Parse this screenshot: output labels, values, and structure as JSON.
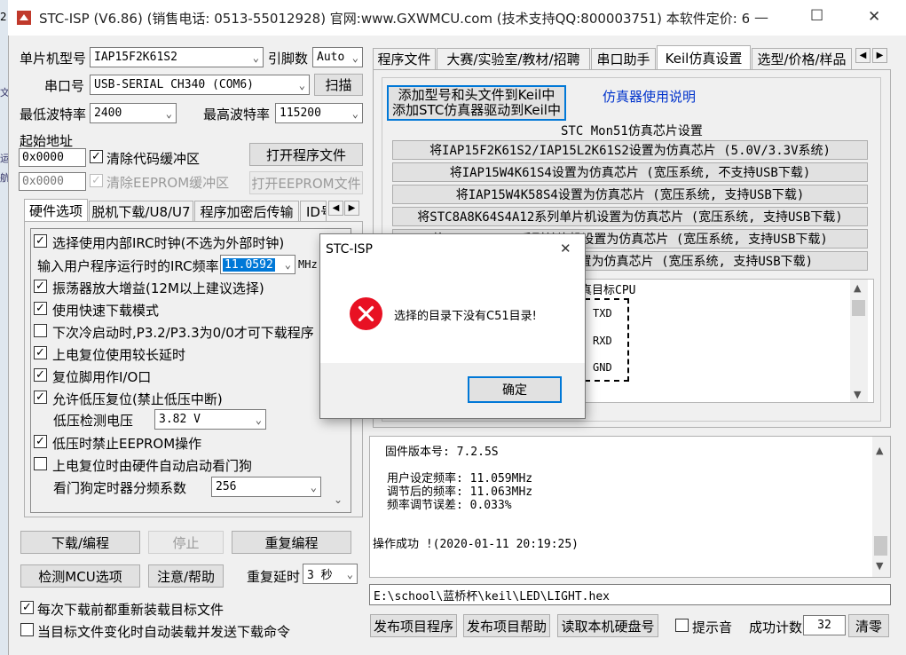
{
  "titlebar": {
    "title": "STC-ISP (V6.86) (销售电话: 0513-55012928) 官网:www.GXWMCU.com  (技术支持QQ:800003751) 本软件定价: 6...",
    "left_strip": "2",
    "minimize_glyph": "—",
    "maximize_glyph": "☐",
    "close_glyph": "✕"
  },
  "left_strip_chars": [
    "文",
    "运",
    "航"
  ],
  "mcu": {
    "model_label": "单片机型号",
    "model_value": "IAP15F2K61S2",
    "pins_label": "引脚数",
    "pins_value": "Auto",
    "port_label": "串口号",
    "port_value": "USB-SERIAL CH340 (COM6)",
    "scan_button": "扫描",
    "min_baud_label": "最低波特率",
    "min_baud_value": "2400",
    "max_baud_label": "最高波特率",
    "max_baud_value": "115200",
    "start_addr_label": "起始地址",
    "addr1_value": "0x0000",
    "clear_code_label": "清除代码缓冲区",
    "open_program_button": "打开程序文件",
    "addr2_value": "0x0000",
    "clear_eeprom_label": "清除EEPROM缓冲区",
    "open_eeprom_button": "打开EEPROM文件"
  },
  "left_tabs": [
    "硬件选项",
    "脱机下载/U8/U7",
    "程序加密后传输",
    "ID号"
  ],
  "options": {
    "irc_label": "选择使用内部IRC时钟(不选为外部时钟)",
    "irc_freq_label": "输入用户程序运行时的IRC频率",
    "irc_freq_value": "11.0592",
    "irc_unit": "MHz",
    "items": [
      {
        "label": "振荡器放大增益(12M以上建议选择)",
        "checked": true
      },
      {
        "label": "使用快速下载模式",
        "checked": true
      },
      {
        "label": "下次冷启动时,P3.2/P3.3为0/0才可下载程序",
        "checked": false
      },
      {
        "label": "上电复位使用较长延时",
        "checked": true
      },
      {
        "label": "复位脚用作I/O口",
        "checked": true
      },
      {
        "label": "允许低压复位(禁止低压中断)",
        "checked": true
      }
    ],
    "lv_label": "低压检测电压",
    "lv_value": "3.82 V",
    "lv_forbid_eeprom": "低压时禁止EEPROM操作",
    "wdt_auto": "上电复位时由硬件自动启动看门狗",
    "wdt_div_label": "看门狗定时器分频系数",
    "wdt_div_value": "256"
  },
  "actions": {
    "download": "下载/编程",
    "stop": "停止",
    "redownload": "重复编程",
    "check_mcu": "检测MCU选项",
    "help": "注意/帮助",
    "repeat_delay_label": "重复延时",
    "repeat_delay_value": "3 秒",
    "reload_label": "每次下载前都重新装载目标文件",
    "auto_load_label": "当目标文件变化时自动装载并发送下载命令"
  },
  "right_tabs": [
    "程序文件",
    "大赛/实验室/教材/招聘",
    "串口助手",
    "Keil仿真设置",
    "选型/价格/样品"
  ],
  "keil": {
    "add_button_line1": "添加型号和头文件到Keil中",
    "add_button_line2": "添加STC仿真器驱动到Keil中",
    "emulator_help": "仿真器使用说明",
    "mon51_title": "STC Mon51仿真芯片设置",
    "buttons": [
      "将IAP15F2K61S2/IAP15L2K61S2设置为仿真芯片 (5.0V/3.3V系统)",
      "将IAP15W4K61S4设置为仿真芯片 (宽压系统, 不支持USB下载)",
      "将IAP15W4K58S4设置为仿真芯片 (宽压系统, 支持USB下载)",
      "将STC8A8K64S4A12系列单片机设置为仿真芯片 (宽压系统, 支持USB下载)",
      "将STC8H8K64U系列单片机设置为仿真芯片 (宽压系统, 支持USB下载)",
      "将STC8G/STC8H系列设置为仿真芯片 (宽压系统, 支持USB下载)"
    ],
    "target_cpu_label": "真目标CPU",
    "pins": [
      "TXD",
      "RXD",
      "GND"
    ]
  },
  "log": {
    "firmware": "固件版本号: 7.2.5S",
    "user_freq": "用户设定频率: 11.059MHz",
    "adj_freq": "调节后的频率: 11.063MHz",
    "freq_err": "频率调节误差: 0.033%",
    "success": "操作成功 !(2020-01-11 20:19:25)"
  },
  "file_path": "E:\\school\\蓝桥杯\\keil\\LED\\LIGHT.hex",
  "bottom": {
    "publish_program": "发布项目程序",
    "publish_help": "发布项目帮助",
    "read_disk": "读取本机硬盘号",
    "beep_label": "提示音",
    "success_count_label": "成功计数",
    "success_count_value": "32",
    "clear_button": "清零"
  },
  "dialog": {
    "title": "STC-ISP",
    "message": "选择的目录下没有C51目录!",
    "ok": "确定",
    "close_glyph": "✕",
    "error_color": "#e81123"
  }
}
